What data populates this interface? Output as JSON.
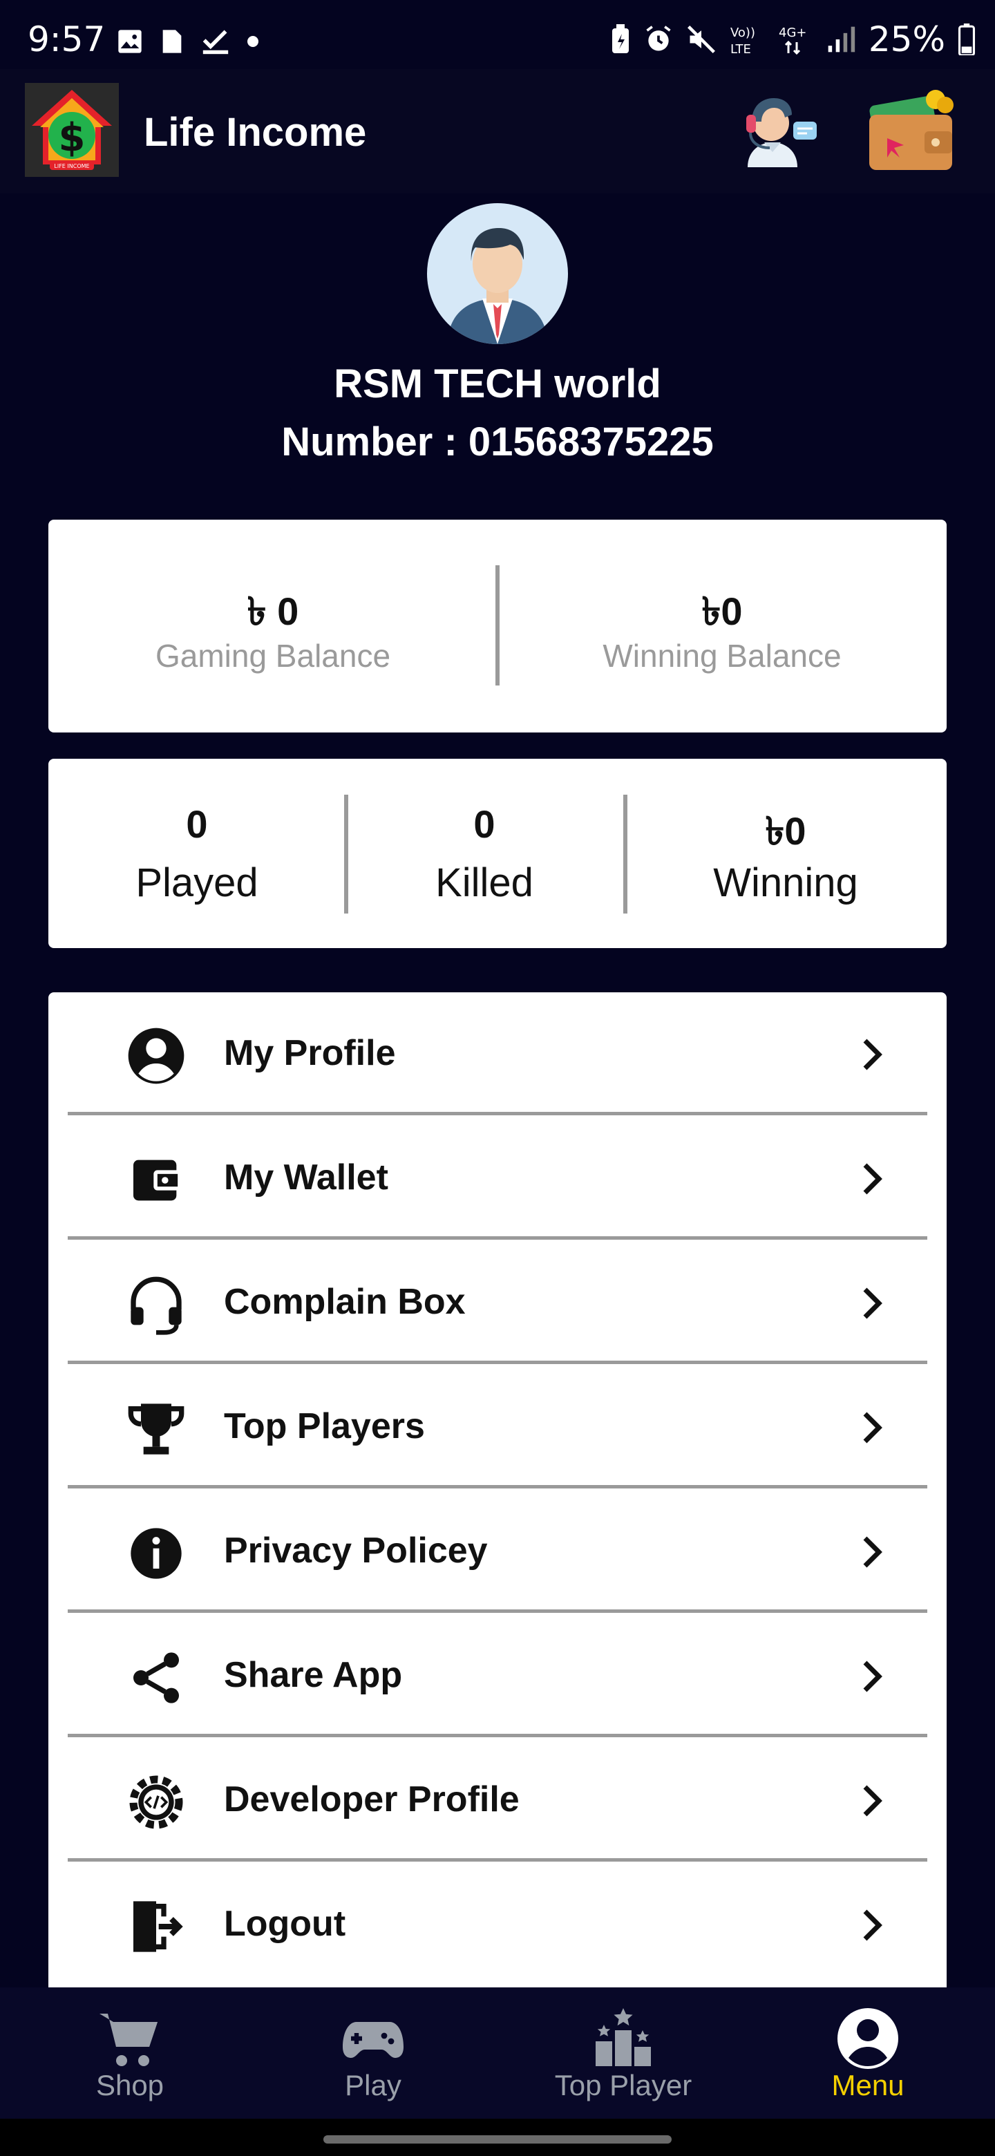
{
  "status_bar": {
    "time": "9:57",
    "battery": "25%",
    "network": "4G+",
    "icons": [
      "image-icon",
      "sim-icon",
      "check-icon",
      "dot-icon",
      "battery-saver-icon",
      "alarm-icon",
      "mute-icon",
      "volte-icon",
      "signal-icon",
      "battery-icon"
    ]
  },
  "app_bar": {
    "title": "Life Income",
    "logo_text": "LIFE INCOME"
  },
  "profile": {
    "name": "RSM TECH world",
    "number": "Number : 01568375225"
  },
  "balances": {
    "gaming_value": "৳ 0",
    "gaming_label": "Gaming Balance",
    "winning_value": "৳0",
    "winning_label": "Winning Balance"
  },
  "stats": [
    {
      "value": "0",
      "label": "Played"
    },
    {
      "value": "0",
      "label": "Killed"
    },
    {
      "value": "৳0",
      "label": "Winning"
    }
  ],
  "menu": [
    {
      "label": "My Profile",
      "icon": "account-circle-icon"
    },
    {
      "label": "My Wallet",
      "icon": "wallet-icon"
    },
    {
      "label": "Complain Box",
      "icon": "headset-icon"
    },
    {
      "label": "Top Players",
      "icon": "trophy-icon"
    },
    {
      "label": "Privacy Policey",
      "icon": "info-icon"
    },
    {
      "label": "Share App",
      "icon": "share-icon"
    },
    {
      "label": "Developer Profile",
      "icon": "developer-gear-icon"
    },
    {
      "label": "Logout",
      "icon": "logout-icon"
    }
  ],
  "bottom_nav": [
    {
      "label": "Shop",
      "icon": "cart-icon",
      "active": false
    },
    {
      "label": "Play",
      "icon": "gamepad-icon",
      "active": false
    },
    {
      "label": "Top Player",
      "icon": "podium-icon",
      "active": false
    },
    {
      "label": "Menu",
      "icon": "account-circle-icon",
      "active": true
    }
  ],
  "colors": {
    "background": "#040420",
    "card": "#ffffff",
    "active_nav": "#f5d000",
    "inactive_nav": "#9aa0aa",
    "divider": "#9a9a9a"
  }
}
